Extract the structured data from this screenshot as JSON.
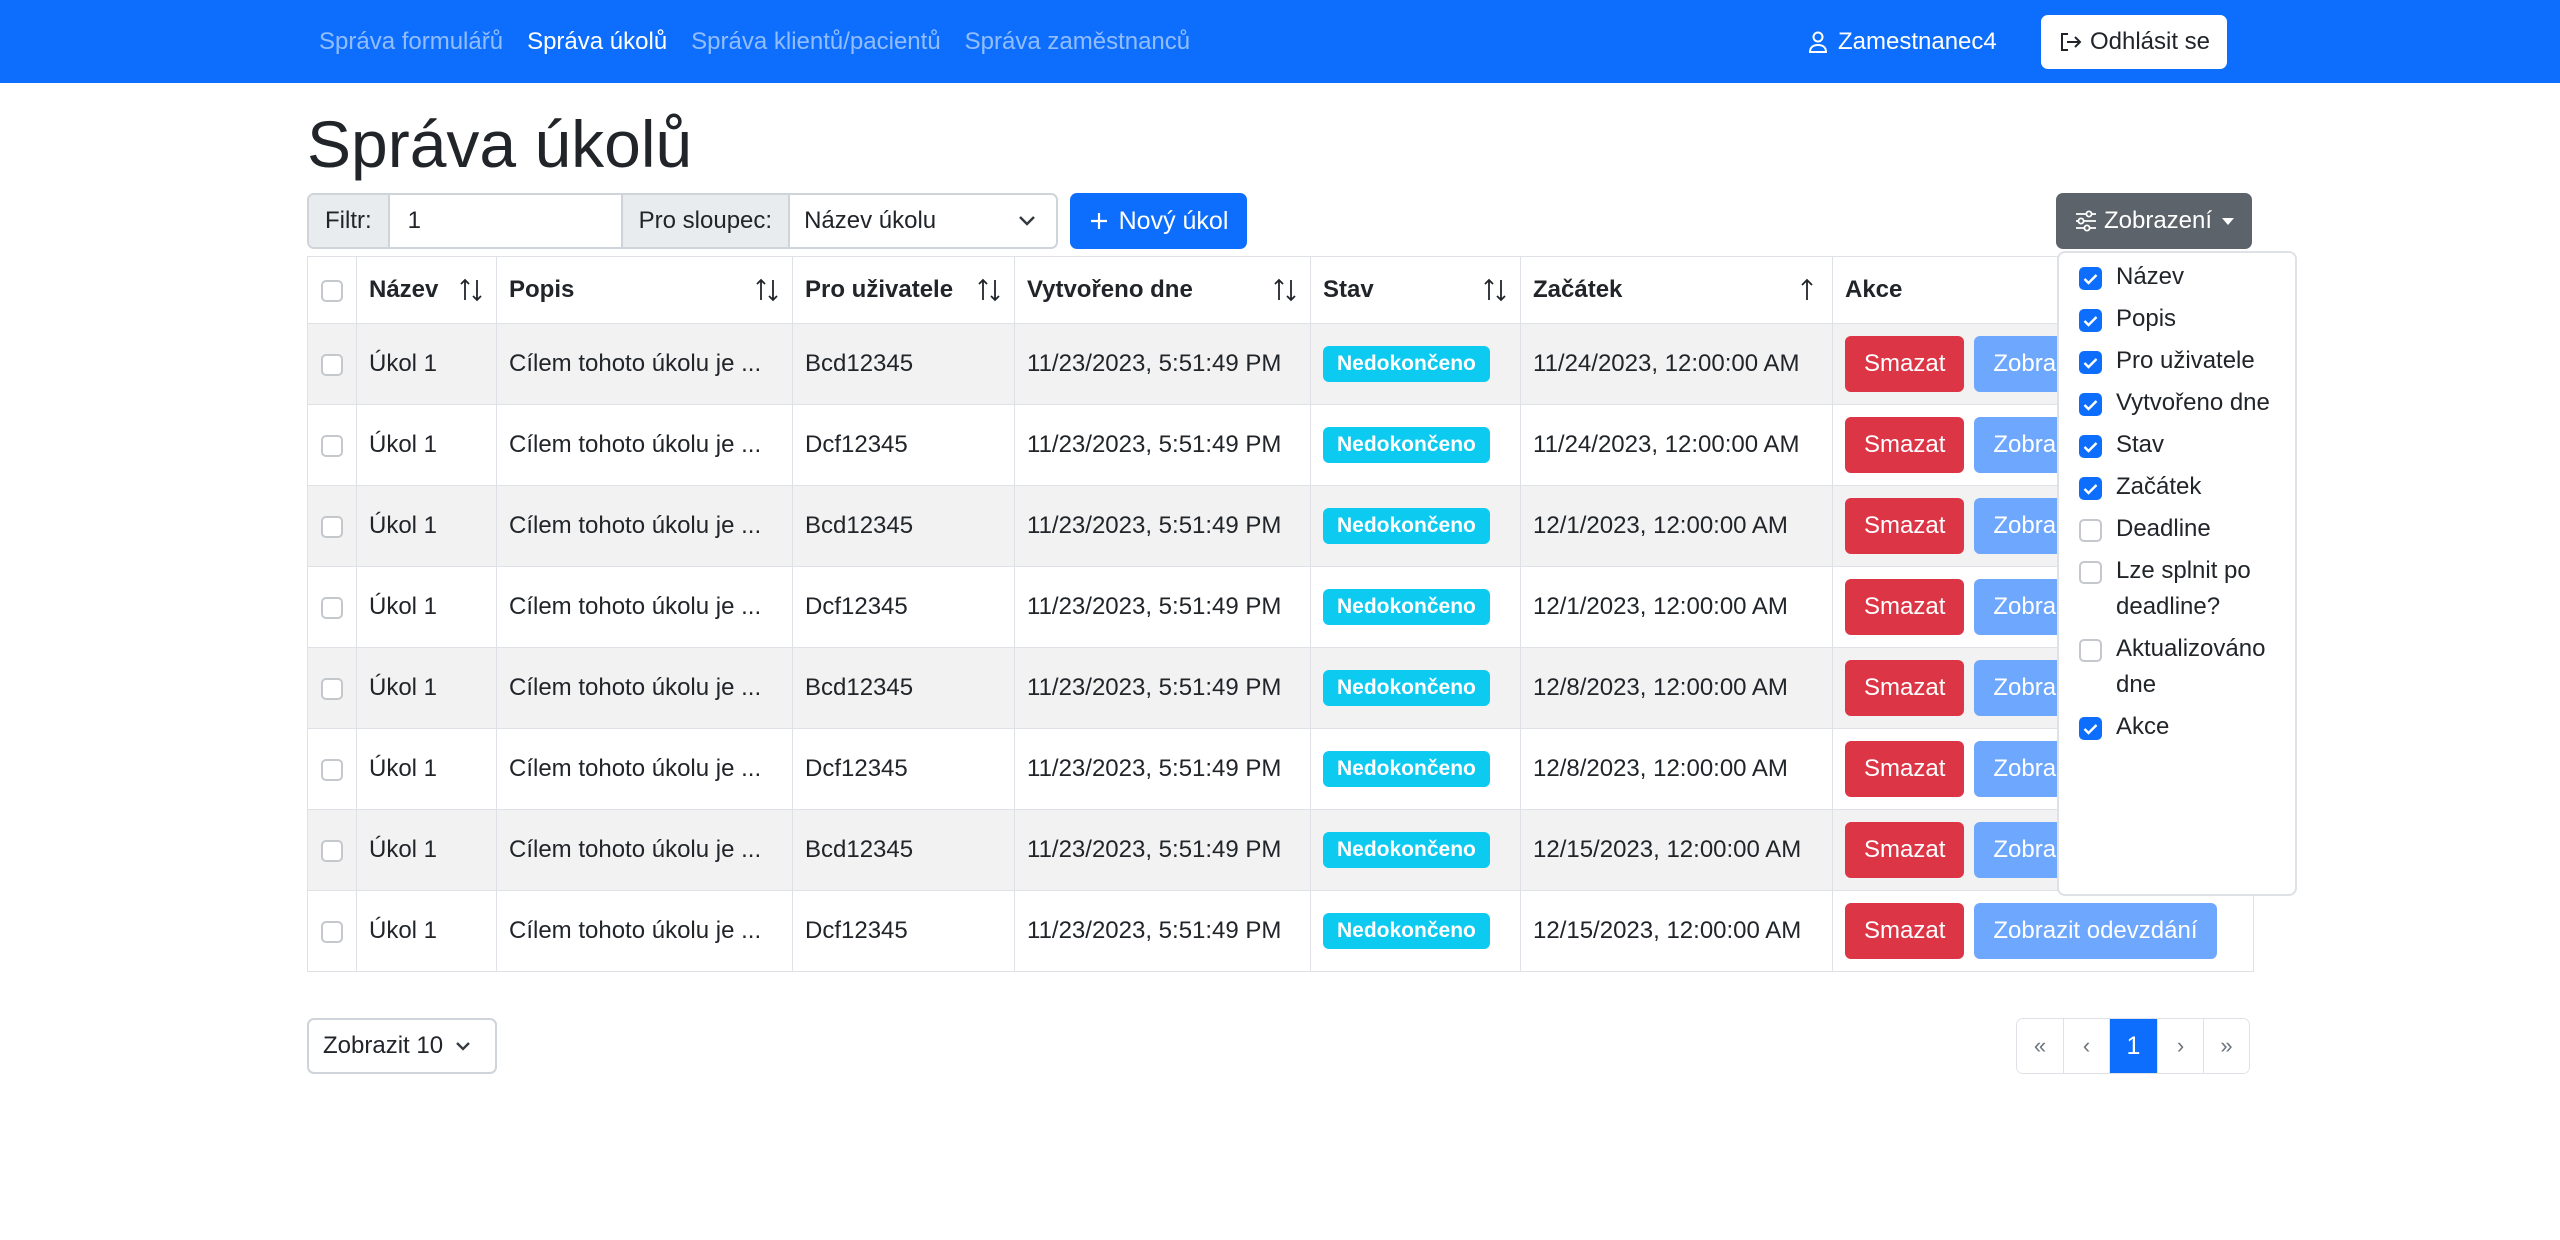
{
  "nav": {
    "links": [
      {
        "label": "Správa formulářů",
        "active": false
      },
      {
        "label": "Správa úkolů",
        "active": true
      },
      {
        "label": "Správa klientů/pacientů",
        "active": false
      },
      {
        "label": "Správa zaměstnanců",
        "active": false
      }
    ],
    "user": "Zamestnanec4",
    "logout": "Odhlásit se"
  },
  "page_title": "Správa úkolů",
  "toolbar": {
    "filter_label": "Filtr:",
    "filter_value": "1",
    "column_label": "Pro sloupec:",
    "column_selected": "Název úkolu",
    "new_task": "Nový úkol",
    "view_button": "Zobrazení"
  },
  "table": {
    "headers": [
      "Název",
      "Popis",
      "Pro uživatele",
      "Vytvořeno dne",
      "Stav",
      "Začátek",
      "Akce"
    ],
    "rows": [
      {
        "name": "Úkol 1",
        "desc": "Cílem tohoto úkolu je ...",
        "user": "Bcd12345",
        "created": "11/23/2023, 5:51:49 PM",
        "status": "Nedokončeno",
        "start": "11/24/2023, 12:00:00 AM"
      },
      {
        "name": "Úkol 1",
        "desc": "Cílem tohoto úkolu je ...",
        "user": "Dcf12345",
        "created": "11/23/2023, 5:51:49 PM",
        "status": "Nedokončeno",
        "start": "11/24/2023, 12:00:00 AM"
      },
      {
        "name": "Úkol 1",
        "desc": "Cílem tohoto úkolu je ...",
        "user": "Bcd12345",
        "created": "11/23/2023, 5:51:49 PM",
        "status": "Nedokončeno",
        "start": "12/1/2023, 12:00:00 AM"
      },
      {
        "name": "Úkol 1",
        "desc": "Cílem tohoto úkolu je ...",
        "user": "Dcf12345",
        "created": "11/23/2023, 5:51:49 PM",
        "status": "Nedokončeno",
        "start": "12/1/2023, 12:00:00 AM"
      },
      {
        "name": "Úkol 1",
        "desc": "Cílem tohoto úkolu je ...",
        "user": "Bcd12345",
        "created": "11/23/2023, 5:51:49 PM",
        "status": "Nedokončeno",
        "start": "12/8/2023, 12:00:00 AM"
      },
      {
        "name": "Úkol 1",
        "desc": "Cílem tohoto úkolu je ...",
        "user": "Dcf12345",
        "created": "11/23/2023, 5:51:49 PM",
        "status": "Nedokončeno",
        "start": "12/8/2023, 12:00:00 AM"
      },
      {
        "name": "Úkol 1",
        "desc": "Cílem tohoto úkolu je ...",
        "user": "Bcd12345",
        "created": "11/23/2023, 5:51:49 PM",
        "status": "Nedokončeno",
        "start": "12/15/2023, 12:00:00 AM"
      },
      {
        "name": "Úkol 1",
        "desc": "Cílem tohoto úkolu je ...",
        "user": "Dcf12345",
        "created": "11/23/2023, 5:51:49 PM",
        "status": "Nedokončeno",
        "start": "12/15/2023, 12:00:00 AM"
      }
    ],
    "delete_label": "Smazat",
    "show_label": "Zobrazit odevzdání"
  },
  "column_menu": [
    {
      "label": "Název",
      "checked": true
    },
    {
      "label": "Popis",
      "checked": true
    },
    {
      "label": "Pro uživatele",
      "checked": true
    },
    {
      "label": "Vytvořeno dne",
      "checked": true
    },
    {
      "label": "Stav",
      "checked": true
    },
    {
      "label": "Začátek",
      "checked": true
    },
    {
      "label": "Deadline",
      "checked": false
    },
    {
      "label": "Lze splnit po deadline?",
      "checked": false
    },
    {
      "label": "Aktualizováno dne",
      "checked": false
    },
    {
      "label": "Akce",
      "checked": true
    }
  ],
  "page_size": "Zobrazit 10",
  "pagination": {
    "first": "«",
    "prev": "‹",
    "current": "1",
    "next": "›",
    "last": "»"
  },
  "colors": {
    "primary": "#0d6efd",
    "danger": "#dc3545",
    "info": "#0dcaf0",
    "secondary": "#5c636a"
  },
  "icons": [
    "person-icon",
    "logout-icon",
    "plus-icon",
    "sliders-icon",
    "sort-icon",
    "sort-up-icon",
    "chevron-down-icon",
    "check-icon"
  ]
}
